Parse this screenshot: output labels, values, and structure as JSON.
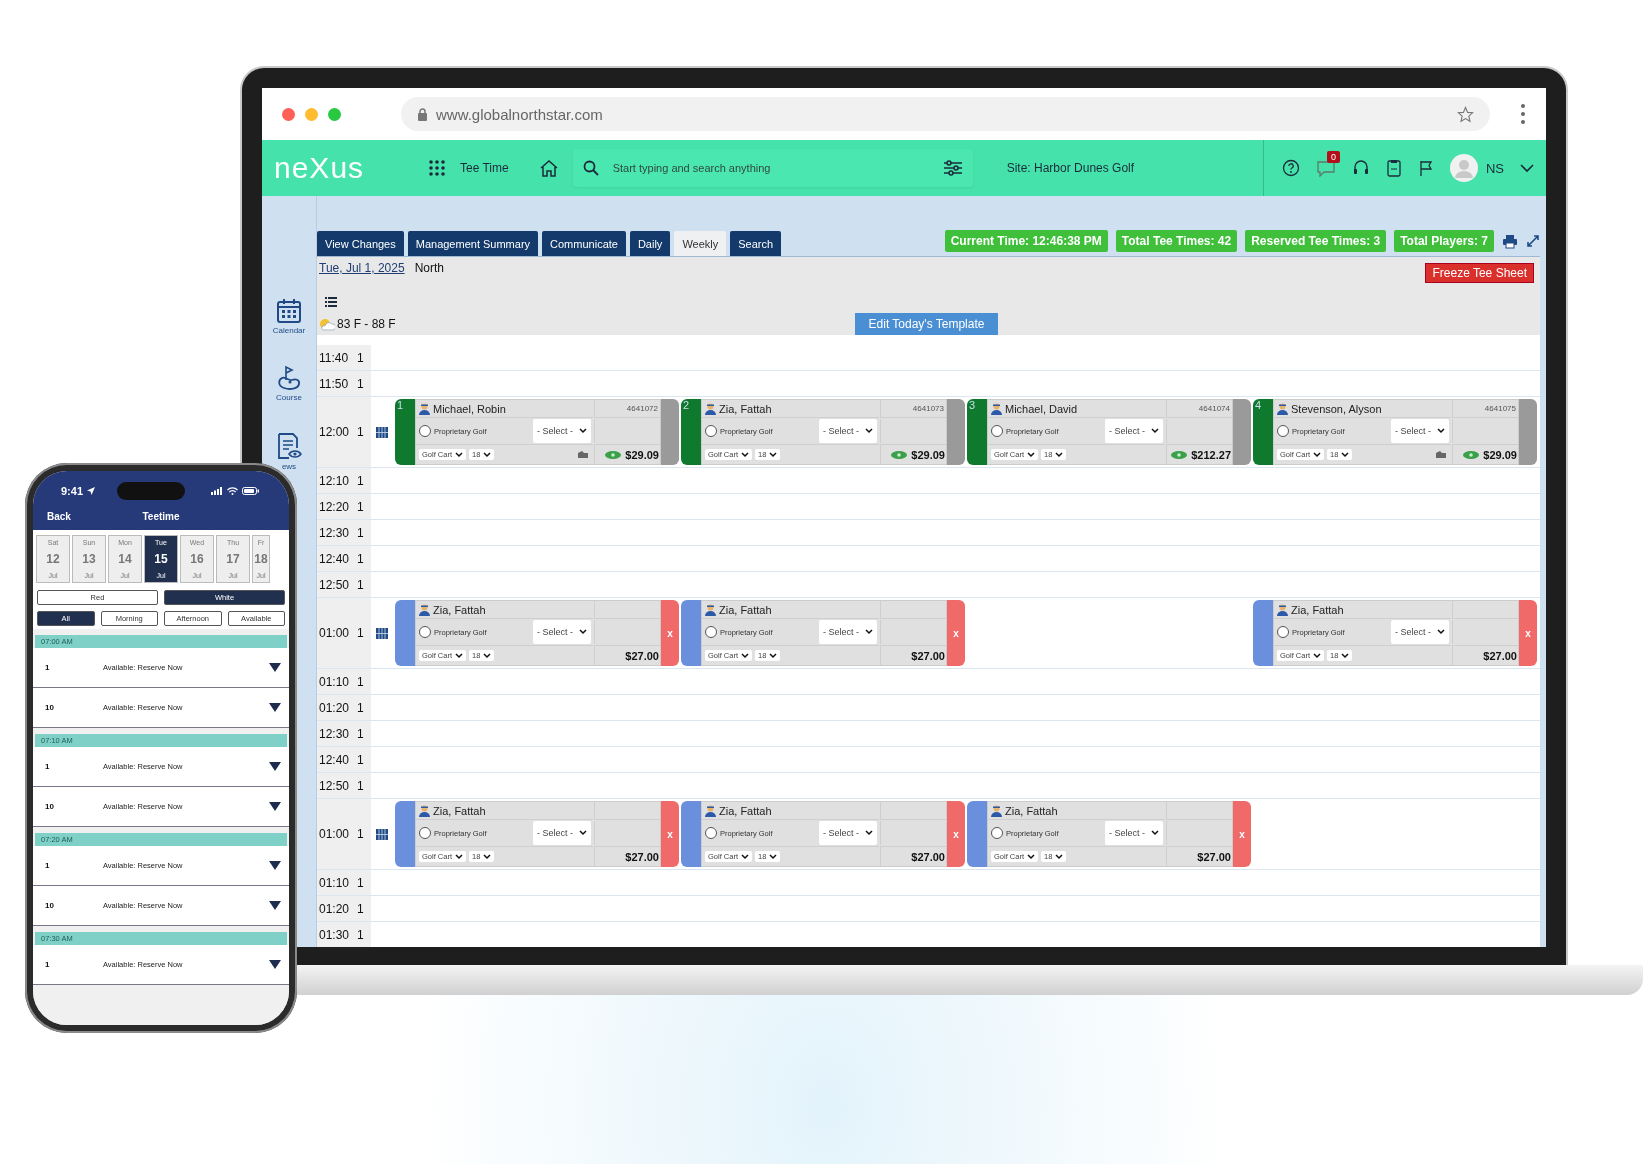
{
  "browser": {
    "url": "www.globalnorthstar.com"
  },
  "app_header": {
    "logo": "neXus",
    "module": "Tee Time",
    "search": {
      "placeholder": "Start typing and search anything"
    },
    "site": "Site: Harbor Dunes Golf",
    "notification_count": "0",
    "user_initials": "NS"
  },
  "sidebar": {
    "items": [
      {
        "label": "Calendar",
        "kind": "calendar"
      },
      {
        "label": "Course",
        "kind": "course"
      },
      {
        "label": "ews",
        "kind": "news"
      }
    ]
  },
  "tabs": [
    {
      "label": "View Changes",
      "selected": false
    },
    {
      "label": "Management Summary",
      "selected": false
    },
    {
      "label": "Communicate",
      "selected": false
    },
    {
      "label": "Daily",
      "selected": false
    },
    {
      "label": "Weekly",
      "selected": true
    },
    {
      "label": "Search",
      "selected": false
    }
  ],
  "stats": [
    "Current Time: 12:46:38 PM",
    "Total Tee Times: 42",
    "Reserved Tee Times: 3",
    "Total Players: 7"
  ],
  "date": "Tue, Jul 1, 2025",
  "course": "North",
  "freeze_button": "Freeze Tee Sheet",
  "weather": "83 F - 88 F",
  "template_button": "Edit Today's Template",
  "slots": [
    {
      "time": "11:40",
      "count": "1"
    },
    {
      "time": "11:50",
      "count": "1"
    },
    {
      "time": "12:00",
      "count": "1",
      "bookings": [
        {
          "kind": "reserved",
          "number": "1",
          "name": "Michael, Robin",
          "id": "4641072",
          "checked": false,
          "product": "Proprietary Golf",
          "select": "- Select -",
          "cart": "Golf Cart",
          "holes": "18",
          "price": "$29.09",
          "note": true
        },
        {
          "kind": "reserved",
          "number": "2",
          "name": "Zia, Fattah",
          "id": "4641073",
          "checked": false,
          "product": "Proprietary Golf",
          "select": "- Select -",
          "cart": "Golf Cart",
          "holes": "18",
          "price": "$29.09",
          "note": false
        },
        {
          "kind": "reserved",
          "number": "3",
          "name": "Michael, David",
          "id": "4641074",
          "checked": false,
          "product": "Proprietary Golf",
          "select": "- Select -",
          "cart": "Golf Cart",
          "holes": "18",
          "price": "$212.27",
          "note": false
        },
        {
          "kind": "reserved",
          "number": "4",
          "name": "Stevenson, Alyson",
          "id": "4641075",
          "checked": false,
          "product": "Proprietary Golf",
          "select": "- Select -",
          "cart": "Golf Cart",
          "holes": "18",
          "price": "$29.09",
          "note": true
        }
      ]
    },
    {
      "time": "12:10",
      "count": "1"
    },
    {
      "time": "12:20",
      "count": "1"
    },
    {
      "time": "12:30",
      "count": "1"
    },
    {
      "time": "12:40",
      "count": "1"
    },
    {
      "time": "12:50",
      "count": "1"
    },
    {
      "time": "01:00",
      "count": "1",
      "bookings": [
        {
          "kind": "pending",
          "name": "Zia, Fattah",
          "checked": false,
          "product": "Proprietary Golf",
          "select": "- Select -",
          "cart": "Golf Cart",
          "holes": "18",
          "price": "$27.00",
          "remove": "x",
          "note": false
        },
        {
          "kind": "pending",
          "name": "Zia, Fattah",
          "checked": false,
          "product": "Proprietary Golf",
          "select": "- Select -",
          "cart": "Golf Cart",
          "holes": "18",
          "price": "$27.00",
          "remove": "x",
          "note": false
        },
        {
          "kind": "empty"
        },
        {
          "kind": "pending",
          "name": "Zia, Fattah",
          "checked": false,
          "product": "Proprietary Golf",
          "select": "- Select -",
          "cart": "Golf Cart",
          "holes": "18",
          "price": "$27.00",
          "remove": "x",
          "note": false
        }
      ]
    },
    {
      "time": "01:10",
      "count": "1"
    },
    {
      "time": "01:20",
      "count": "1"
    },
    {
      "time": "12:30",
      "count": "1"
    },
    {
      "time": "12:40",
      "count": "1"
    },
    {
      "time": "12:50",
      "count": "1"
    },
    {
      "time": "01:00",
      "count": "1",
      "bookings": [
        {
          "kind": "pending",
          "name": "Zia, Fattah",
          "checked": false,
          "product": "Proprietary Golf",
          "select": "- Select -",
          "cart": "Golf Cart",
          "holes": "18",
          "price": "$27.00",
          "remove": "x",
          "note": false
        },
        {
          "kind": "pending",
          "name": "Zia, Fattah",
          "checked": false,
          "product": "Proprietary Golf",
          "select": "- Select -",
          "cart": "Golf Cart",
          "holes": "18",
          "price": "$27.00",
          "remove": "x",
          "note": false
        },
        {
          "kind": "pending",
          "name": "Zia, Fattah",
          "checked": false,
          "product": "Proprietary Golf",
          "select": "- Select -",
          "cart": "Golf Cart",
          "holes": "18",
          "price": "$27.00",
          "remove": "x",
          "note": false
        }
      ]
    },
    {
      "time": "01:10",
      "count": "1"
    },
    {
      "time": "01:20",
      "count": "1"
    },
    {
      "time": "01:30",
      "count": "1"
    }
  ],
  "phone": {
    "clock": "9:41",
    "back": "Back",
    "title": "Teetime",
    "days": [
      {
        "dow": "Sat",
        "day": "12",
        "month": "Jul",
        "selected": false
      },
      {
        "dow": "Sun",
        "day": "13",
        "month": "Jul",
        "selected": false
      },
      {
        "dow": "Mon",
        "day": "14",
        "month": "Jul",
        "selected": false
      },
      {
        "dow": "Tue",
        "day": "15",
        "month": "Jul",
        "selected": true
      },
      {
        "dow": "Wed",
        "day": "16",
        "month": "Jul",
        "selected": false
      },
      {
        "dow": "Thu",
        "day": "17",
        "month": "Jul",
        "selected": false
      },
      {
        "dow": "Fr",
        "day": "18",
        "month": "Jul",
        "selected": false
      }
    ],
    "courses": [
      {
        "label": "Red",
        "selected": false
      },
      {
        "label": "White",
        "selected": true
      }
    ],
    "filters": [
      {
        "label": "All",
        "selected": true
      },
      {
        "label": "Morning",
        "selected": false
      },
      {
        "label": "Afternoon",
        "selected": false
      },
      {
        "label": "Available",
        "selected": false
      }
    ],
    "groups": [
      {
        "time": "07:00 AM",
        "rows": [
          {
            "players": "1",
            "status": "Available: Reserve Now"
          },
          {
            "players": "10",
            "status": "Available: Reserve Now"
          }
        ]
      },
      {
        "time": "07:10 AM",
        "rows": [
          {
            "players": "1",
            "status": "Available: Reserve Now"
          },
          {
            "players": "10",
            "status": "Available: Reserve Now"
          }
        ]
      },
      {
        "time": "07:20 AM",
        "rows": [
          {
            "players": "1",
            "status": "Available: Reserve Now"
          },
          {
            "players": "10",
            "status": "Available: Reserve Now"
          }
        ]
      },
      {
        "time": "07:30 AM",
        "rows": [
          {
            "players": "1",
            "status": "Available: Reserve Now"
          }
        ]
      }
    ]
  }
}
